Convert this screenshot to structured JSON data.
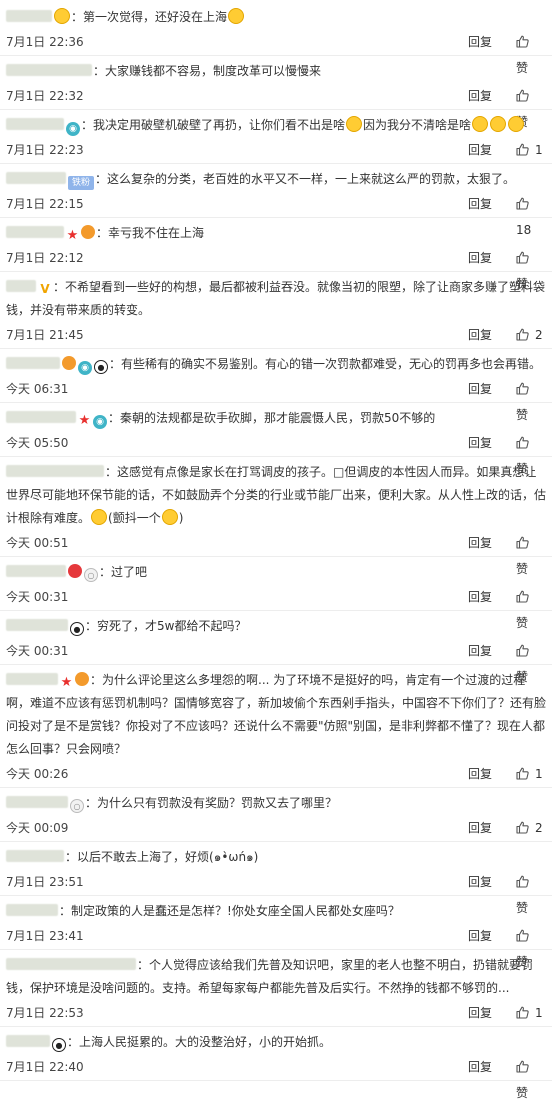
{
  "icons": {
    "like": "thumbs-up-outline-icon"
  },
  "colors": {
    "background": "#ffffff",
    "divider": "#ededed",
    "text": "#333333"
  },
  "comments": [
    {
      "text": "第一次觉得，还好没在上海",
      "time": "7月1日 22:36",
      "reply": "回复",
      "like": "赞",
      "name_w": 46,
      "pre": [
        "emoji-hand"
      ],
      "post": [
        "emoji-tongue"
      ]
    },
    {
      "text": "大家赚钱都不容易，制度改革可以慢慢来",
      "time": "7月1日 22:32",
      "reply": "回复",
      "like": "赞",
      "name_w": 86,
      "pre": [],
      "post": []
    },
    {
      "text": "我决定用破壁机破壁了再扔，让你们看不出是啥",
      "text2": "因为我分不清啥是啥",
      "time": "7月1日 22:23",
      "reply": "回复",
      "like": "1",
      "name_w": 58,
      "pre": [
        "eye"
      ],
      "mid": [
        "emoji-laugh"
      ],
      "post": [
        "emoji-cry",
        "emoji-cry",
        "emoji-cry"
      ]
    },
    {
      "text": "这么复杂的分类，老百姓的水平又不一样，一上来就这么严的罚款，太狠了。",
      "time": "7月1日 22:15",
      "reply": "回复",
      "like": "18",
      "name_w": 60,
      "pre": [
        "fan"
      ],
      "fan_label": "铁粉",
      "post": []
    },
    {
      "text": "幸亏我不住在上海",
      "time": "7月1日 22:12",
      "reply": "回复",
      "like": "赞",
      "name_w": 58,
      "pre": [
        "star",
        "medal"
      ],
      "post": []
    },
    {
      "text": "不希望看到一些好的构想，最后都被利益吞没。就像当初的限塑，除了让商家多赚了塑料袋钱，并没有带来质的转变。",
      "time": "7月1日 21:45",
      "reply": "回复",
      "like": "2",
      "name_w": 30,
      "pre": [
        "v"
      ],
      "post": []
    },
    {
      "text": "有些稀有的确实不易鉴别。有心的错一次罚款都难受，无心的罚再多也会再错。",
      "time": "今天 06:31",
      "reply": "回复",
      "like": "赞",
      "name_w": 54,
      "pre": [
        "medal",
        "eye",
        "panda"
      ],
      "post": []
    },
    {
      "text": "秦朝的法规都是砍手砍脚，那才能震慑人民，罚款50不够的",
      "time": "今天 05:50",
      "reply": "回复",
      "like": "赞",
      "name_w": 70,
      "pre": [
        "star",
        "eye"
      ],
      "post": []
    },
    {
      "text": "这感觉有点像是家长在打骂调皮的孩子。□但调皮的本性因人而异。如果真想让世界尽可能地环保节能的话，不如鼓励弄个分类的行业或节能厂出来，便利大家。从人性上改的话，估计根除有难度。",
      "text_tail": "(颤抖一个",
      "time": "今天 00:51",
      "reply": "回复",
      "like": "赞",
      "name_w": 98,
      "pre": [],
      "post": [
        "emoji-shy"
      ],
      "tail": [
        "emoji-small"
      ]
    },
    {
      "text": "过了吧",
      "time": "今天 00:31",
      "reply": "回复",
      "like": "赞",
      "name_w": 60,
      "pre": [
        "hong",
        "ring"
      ],
      "post": []
    },
    {
      "text": "穷死了，才5w都给不起吗？",
      "time": "今天 00:31",
      "reply": "回复",
      "like": "赞",
      "name_w": 62,
      "pre": [
        "panda"
      ],
      "post": []
    },
    {
      "text": "为什么评论里这么多埋怨的啊... 为了环境不是挺好的吗，肯定有一个过渡的过程啊，难道不应该有惩罚机制吗？国情够宽容了，新加坡偷个东西剁手指头，中国容不下你们了？还有脸问投对了是不是赏钱？你投对了不应该吗？还说什么不需要\"仿照\"别国，是非利弊都不懂了？现在人都怎么回事？只会网喷？",
      "time": "今天 00:26",
      "reply": "回复",
      "like": "1",
      "name_w": 52,
      "pre": [
        "star",
        "medal"
      ],
      "post": []
    },
    {
      "text": "为什么只有罚款没有奖励？罚款又去了哪里？",
      "time": "今天 00:09",
      "reply": "回复",
      "like": "2",
      "name_w": 62,
      "pre": [
        "ring"
      ],
      "post": []
    },
    {
      "text": "以后不敢去上海了，好烦(๑•̀ωń๑)",
      "time": "7月1日 23:51",
      "reply": "回复",
      "like": "赞",
      "name_w": 58,
      "pre": [],
      "post": []
    },
    {
      "text": "制定政策的人是蠢还是怎样？!你处女座全国人民都处女座吗？",
      "time": "7月1日 23:41",
      "reply": "回复",
      "like": "赞",
      "name_w": 52,
      "pre": [],
      "post": []
    },
    {
      "text": "个人觉得应该给我们先普及知识吧，家里的老人也整不明白，扔错就要罚钱，保护环境是没啥问题的。支持。希望每家每户都能先普及后实行。不然挣的钱都不够罚的...",
      "time": "7月1日 22:53",
      "reply": "回复",
      "like": "1",
      "name_w": 130,
      "pre": [],
      "post": []
    },
    {
      "text": "上海人民挺累的。大的没整治好，小的开始抓。",
      "time": "7月1日 22:40",
      "reply": "回复",
      "like": "赞",
      "name_w": 44,
      "pre": [
        "panda"
      ],
      "post": []
    }
  ]
}
